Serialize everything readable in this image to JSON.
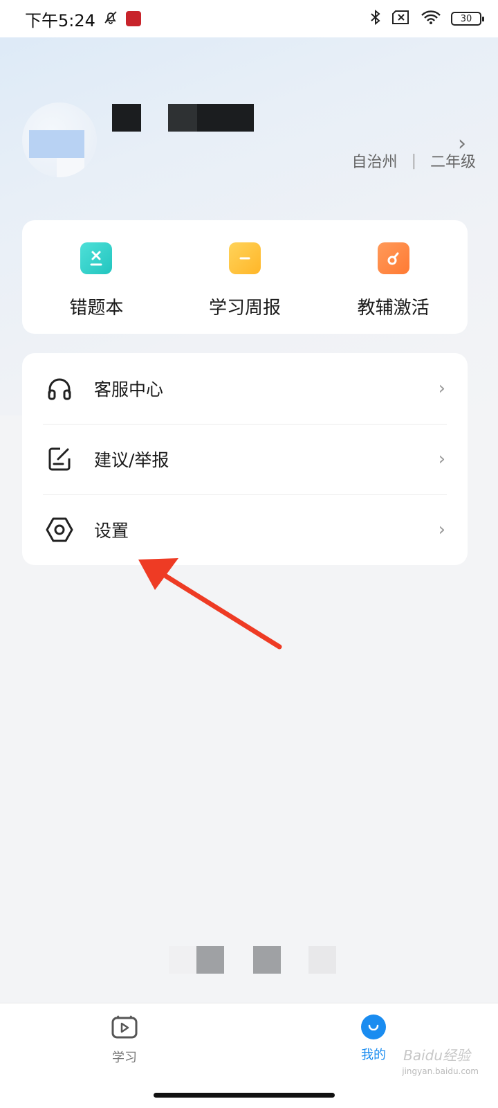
{
  "status_bar": {
    "time": "下午5:24",
    "battery": "30"
  },
  "profile": {
    "region": "自治州",
    "grade": "二年级",
    "separator": "|"
  },
  "quick_actions": [
    {
      "label": "错题本",
      "icon": "error-book-icon",
      "color": "#2fd1c9"
    },
    {
      "label": "学习周报",
      "icon": "weekly-report-icon",
      "color": "#ffc23c"
    },
    {
      "label": "教辅激活",
      "icon": "activate-icon",
      "color": "#ff8a45"
    }
  ],
  "menu": [
    {
      "label": "客服中心",
      "icon": "headset-icon"
    },
    {
      "label": "建议/举报",
      "icon": "feedback-icon"
    },
    {
      "label": "设置",
      "icon": "settings-icon"
    }
  ],
  "bottom_nav": [
    {
      "label": "学习",
      "icon": "play-icon",
      "active": false
    },
    {
      "label": "我的",
      "icon": "profile-icon",
      "active": true
    }
  ],
  "watermark": {
    "text": "Baidu经验",
    "sub": "jingyan.baidu.com"
  },
  "colors": {
    "accent": "#1a8cf0",
    "arrow": "#ee3b24"
  }
}
